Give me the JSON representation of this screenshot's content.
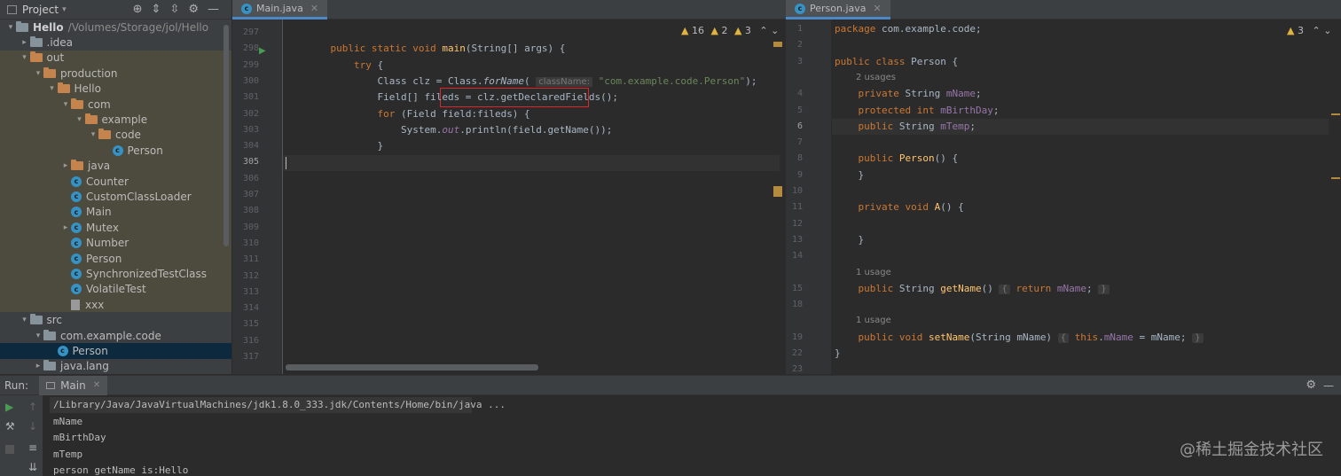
{
  "project": {
    "title": "Project",
    "root": {
      "name": "Hello",
      "path": "/Volumes/Storage/jol/Hello"
    },
    "tree": [
      {
        "label": "Hello",
        "level": 0,
        "arrow": "▾",
        "icon": "folder",
        "bold": true,
        "path": "/Volumes/Storage/jol/Hello"
      },
      {
        "label": ".idea",
        "level": 1,
        "arrow": "▸",
        "icon": "folder"
      },
      {
        "label": "out",
        "level": 1,
        "arrow": "▾",
        "icon": "folder-orange",
        "hl": true
      },
      {
        "label": "production",
        "level": 2,
        "arrow": "▾",
        "icon": "folder-orange",
        "hl": true
      },
      {
        "label": "Hello",
        "level": 3,
        "arrow": "▾",
        "icon": "folder-orange",
        "hl": true
      },
      {
        "label": "com",
        "level": 4,
        "arrow": "▾",
        "icon": "folder-orange",
        "hl": true
      },
      {
        "label": "example",
        "level": 5,
        "arrow": "▾",
        "icon": "folder-orange",
        "hl": true
      },
      {
        "label": "code",
        "level": 6,
        "arrow": "▾",
        "icon": "folder-orange",
        "hl": true
      },
      {
        "label": "Person",
        "level": 7,
        "arrow": "",
        "icon": "class",
        "hl": true
      },
      {
        "label": "java",
        "level": 4,
        "arrow": "▸",
        "icon": "folder-orange",
        "hl": true
      },
      {
        "label": "Counter",
        "level": 4,
        "arrow": "",
        "icon": "class",
        "hl": true
      },
      {
        "label": "CustomClassLoader",
        "level": 4,
        "arrow": "",
        "icon": "class",
        "hl": true
      },
      {
        "label": "Main",
        "level": 4,
        "arrow": "",
        "icon": "class",
        "hl": true
      },
      {
        "label": "Mutex",
        "level": 4,
        "arrow": "▸",
        "icon": "class",
        "hl": true
      },
      {
        "label": "Number",
        "level": 4,
        "arrow": "",
        "icon": "class",
        "hl": true
      },
      {
        "label": "Person",
        "level": 4,
        "arrow": "",
        "icon": "class",
        "hl": true
      },
      {
        "label": "SynchronizedTestClass",
        "level": 4,
        "arrow": "",
        "icon": "class",
        "hl": true
      },
      {
        "label": "VolatileTest",
        "level": 4,
        "arrow": "",
        "icon": "class",
        "hl": true
      },
      {
        "label": "xxx",
        "level": 4,
        "arrow": "",
        "icon": "file",
        "hl": true
      },
      {
        "label": "src",
        "level": 1,
        "arrow": "▾",
        "icon": "folder"
      },
      {
        "label": "com.example.code",
        "level": 2,
        "arrow": "▾",
        "icon": "folder"
      },
      {
        "label": "Person",
        "level": 3,
        "arrow": "",
        "icon": "class",
        "sel": true
      },
      {
        "label": "java.lang",
        "level": 2,
        "arrow": "▸",
        "icon": "folder"
      }
    ]
  },
  "main_editor": {
    "tab": "Main.java",
    "warnings": {
      "warn": "16",
      "weak": "2",
      "ok": "3"
    },
    "lines": [
      {
        "n": "297",
        "html": ""
      },
      {
        "n": "298",
        "html": "    <span class='kw'>public static void</span> <span class='fn'>main</span>(String[] args) {"
      },
      {
        "n": "299",
        "html": "        <span class='kw'>try</span> {"
      },
      {
        "n": "300",
        "html": "            Class clz = Class.<span class='it'>forName</span>( <span class='hint'>className:</span> <span class='str'>\"com.example.code.Person\"</span>);"
      },
      {
        "n": "301",
        "html": "            Field[] fileds = clz.getDeclaredFields();"
      },
      {
        "n": "302",
        "html": "            <span class='kw'>for</span> (Field field:fileds) {"
      },
      {
        "n": "303",
        "html": "                System.<span class='fld it'>out</span>.println(field.getName());"
      },
      {
        "n": "304",
        "html": "            }"
      },
      {
        "n": "305",
        "html": ""
      },
      {
        "n": "306",
        "html": ""
      },
      {
        "n": "307",
        "html": ""
      },
      {
        "n": "308",
        "html": ""
      },
      {
        "n": "309",
        "html": ""
      },
      {
        "n": "310",
        "html": ""
      },
      {
        "n": "311",
        "html": ""
      },
      {
        "n": "312",
        "html": ""
      },
      {
        "n": "313",
        "html": ""
      },
      {
        "n": "314",
        "html": ""
      },
      {
        "n": "315",
        "html": ""
      },
      {
        "n": "316",
        "html": ""
      },
      {
        "n": "317",
        "html": ""
      }
    ]
  },
  "person_editor": {
    "tab": "Person.java",
    "warnings": {
      "warn": "3"
    },
    "lines": [
      {
        "n": "1",
        "html": "<span class='kw'>package</span> com.example.code;"
      },
      {
        "n": "2",
        "html": ""
      },
      {
        "n": "3",
        "html": "<span class='kw'>public class</span> Person {"
      },
      {
        "n": "",
        "usage": "2 usages"
      },
      {
        "n": "4",
        "html": "    <span class='kw'>private</span> String <span class='fld'>mName</span>;"
      },
      {
        "n": "5",
        "html": "    <span class='kw'>protected int</span> <span class='fld'>mBirthDay</span>;"
      },
      {
        "n": "6",
        "html": "    <span class='kw'>public</span> String <span class='fld'>mTemp</span>;"
      },
      {
        "n": "7",
        "html": ""
      },
      {
        "n": "8",
        "html": "    <span class='kw'>public</span> <span class='fn'>Person</span>() {"
      },
      {
        "n": "9",
        "html": "    }"
      },
      {
        "n": "10",
        "html": ""
      },
      {
        "n": "11",
        "html": "    <span class='kw'>private void</span> <span class='fn'>A</span>() {"
      },
      {
        "n": "12",
        "html": ""
      },
      {
        "n": "13",
        "html": "    }"
      },
      {
        "n": "14",
        "html": ""
      },
      {
        "n": "",
        "usage": "1 usage"
      },
      {
        "n": "15",
        "html": "    <span class='kw'>public</span> String <span class='fn'>getName</span>() <span class='hint'>{</span> <span class='kw'>return</span> <span class='fld'>mName</span>; <span class='hint'>}</span>"
      },
      {
        "n": "18",
        "html": ""
      },
      {
        "n": "",
        "usage": "1 usage"
      },
      {
        "n": "19",
        "html": "    <span class='kw'>public void</span> <span class='fn'>setName</span>(String mName) <span class='hint'>{</span> <span class='kw'>this</span>.<span class='fld'>mName</span> = mName; <span class='hint'>}</span>"
      },
      {
        "n": "22",
        "html": "}"
      },
      {
        "n": "23",
        "html": ""
      }
    ]
  },
  "run": {
    "label": "Run:",
    "config": "Main",
    "output": [
      "/Library/Java/JavaVirtualMachines/jdk1.8.0_333.jdk/Contents/Home/bin/java ...",
      "mName",
      "mBirthDay",
      "mTemp",
      "person getName is:Hello"
    ]
  },
  "watermark": "@稀土掘金技术社区"
}
